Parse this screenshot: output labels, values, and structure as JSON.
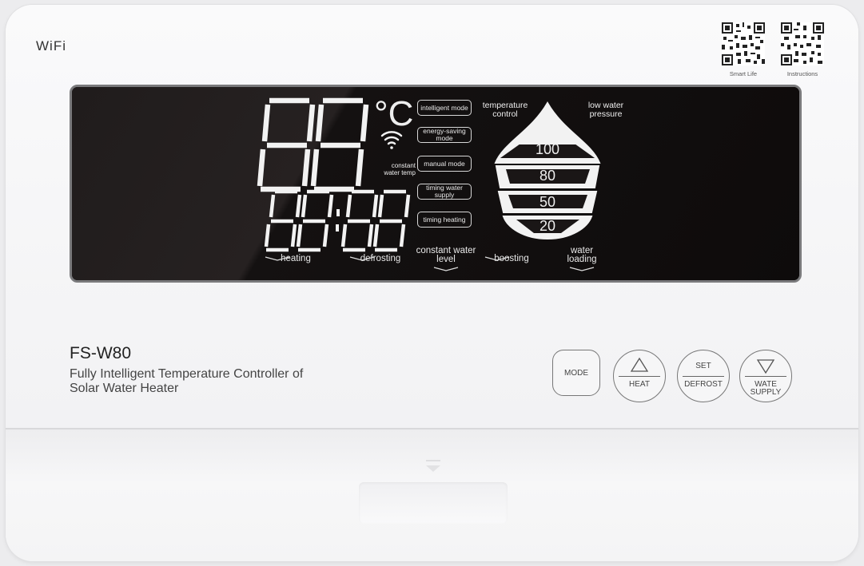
{
  "header": {
    "wifi_label": "WiFi",
    "qr_left_caption": "Smart Life",
    "qr_right_caption": "Instructions"
  },
  "lcd": {
    "unit": "°C",
    "constant_water_temp": [
      "constant",
      "water temp"
    ],
    "modes": [
      {
        "label": "intelligent mode"
      },
      {
        "label": "energy-saving mode"
      },
      {
        "label": "manual mode"
      },
      {
        "label": "timing water supply"
      },
      {
        "label": "timing heating"
      }
    ],
    "temperature_control": [
      "temperature",
      "control"
    ],
    "low_water_pressure": [
      "low water",
      "pressure"
    ],
    "water_levels": [
      "100",
      "80",
      "50",
      "20"
    ],
    "bottom_labels": [
      "heating",
      "defrosting",
      "constant water level",
      "boosting",
      "water loading"
    ]
  },
  "product": {
    "model": "FS-W80",
    "description_line1": "Fully Intelligent Temperature Controller of",
    "description_line2": "Solar Water Heater"
  },
  "buttons": {
    "mode": "MODE",
    "heat_label": "HEAT",
    "set_label": "SET",
    "defrost_label": "DEFROST",
    "wate_label": "WATE",
    "supply_label": "SUPPLY"
  },
  "icons": [
    "wifi-icon",
    "up-triangle-icon",
    "down-triangle-icon",
    "chevron-down-icon",
    "qr-code-icon"
  ]
}
